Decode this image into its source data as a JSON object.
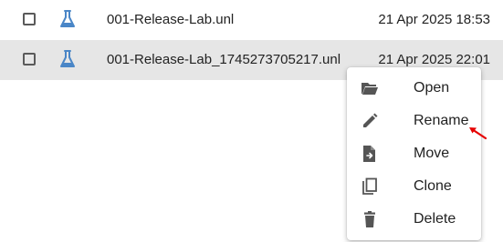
{
  "files": [
    {
      "name": "001-Release-Lab.unl",
      "modified": "21 Apr 2025 18:53",
      "icon": "lab-flask-icon"
    },
    {
      "name": "001-Release-Lab_1745273705217.unl",
      "modified": "21 Apr 2025 22:01",
      "icon": "lab-flask-icon"
    }
  ],
  "context_menu": {
    "items": [
      {
        "label": "Open",
        "icon": "folder-open-icon"
      },
      {
        "label": "Rename",
        "icon": "pencil-icon"
      },
      {
        "label": "Move",
        "icon": "file-move-icon"
      },
      {
        "label": "Clone",
        "icon": "copy-icon"
      },
      {
        "label": "Delete",
        "icon": "trash-icon"
      }
    ]
  },
  "colors": {
    "selected_row_bg": "#e6e6e6",
    "lab_icon": "#4a86c7",
    "menu_icon": "#555555",
    "annotation_arrow": "#e60000"
  }
}
